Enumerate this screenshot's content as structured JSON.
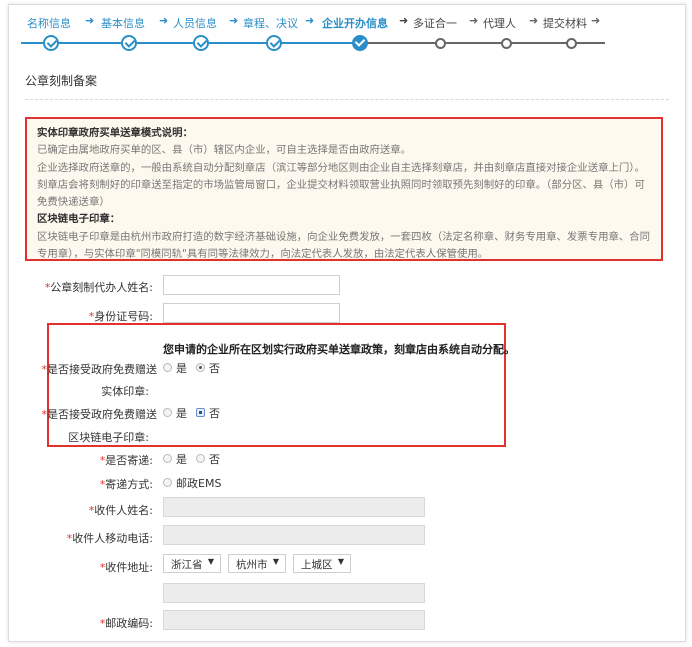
{
  "steps": [
    {
      "label": "名称信息",
      "state": "done"
    },
    {
      "label": "基本信息",
      "state": "done"
    },
    {
      "label": "人员信息",
      "state": "done"
    },
    {
      "label": "章程、决议",
      "state": "done"
    },
    {
      "label": "企业开办信息",
      "state": "current"
    },
    {
      "label": "多证合一",
      "state": "todo"
    },
    {
      "label": "代理人",
      "state": "todo"
    },
    {
      "label": "提交材料",
      "state": "todo"
    }
  ],
  "section_title": "公章刻制备案",
  "notice": {
    "heading1": "实体印章政府买单送章模式说明：",
    "p1": "已确定由属地政府买单的区、县（市）辖区内企业，可自主选择是否由政府送章。",
    "p2": "企业选择政府送章的，一般由系统自动分配刻章店（滨江等部分地区则由企业自主选择刻章店，并由刻章店直接对接企业送章上门）。",
    "p3": "刻章店会将刻制好的印章送至指定的市场监管局窗口，企业提交材料领取营业执照同时领取预先刻制好的印章。（部分区、县（市）可免费快递送章）",
    "heading2": "区块链电子印章：",
    "p4": "区块链电子印章是由杭州市政府打造的数字经济基础设施，向企业免费发放，一套四枚（法定名称章、财务专用章、发票专用章、合同专用章），与实体印章\"同模同轨\"具有同等法律效力，向法定代表人发放，由法定代表人保管使用。"
  },
  "form": {
    "required_mark": "*",
    "agent_name_label": "公章刻制代办人姓名:",
    "id_number_label": "身份证号码:",
    "policy_text": "您申请的企业所在区划实行政府买单送章政策，刻章店由系统自动分配。",
    "free_physical_label_1": "是否接受政府免费赠送",
    "free_physical_label_2": "实体印章:",
    "free_blockchain_label_1": "是否接受政府免费赠送",
    "free_blockchain_label_2": "区块链电子印章:",
    "yes": "是",
    "no": "否",
    "mail_label": "是否寄递:",
    "mail_method_label": "寄递方式:",
    "mail_method_option": "邮政EMS",
    "recipient_name_label": "收件人姓名:",
    "recipient_phone_label": "收件人移动电话:",
    "address_label": "收件地址:",
    "province": "浙江省",
    "city": "杭州市",
    "district": "上城区",
    "postcode_label": "邮政编码:"
  }
}
